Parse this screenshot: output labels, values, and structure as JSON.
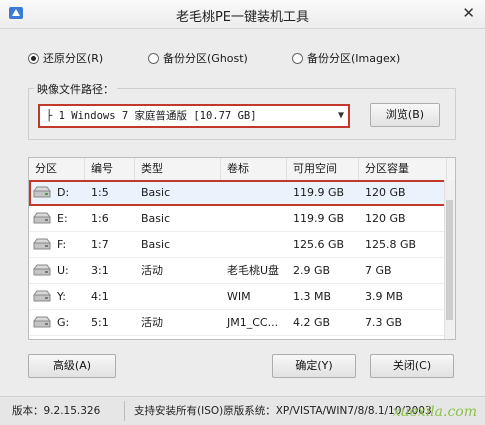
{
  "window": {
    "title": "老毛桃PE一键装机工具",
    "close_glyph": "✕"
  },
  "modes": [
    {
      "label": "还原分区(R)",
      "selected": true
    },
    {
      "label": "备份分区(Ghost)",
      "selected": false
    },
    {
      "label": "备份分区(Imagex)",
      "selected": false
    }
  ],
  "image_path": {
    "label": "映像文件路径：",
    "value": "├ 1 Windows 7 家庭普通版 [10.77 GB]",
    "browse_label": "浏览(B)"
  },
  "table": {
    "headers": [
      "分区",
      "编号",
      "类型",
      "卷标",
      "可用空间",
      "分区容量"
    ],
    "rows": [
      {
        "drive": "D:",
        "number": "1:5",
        "type": "Basic",
        "label": "",
        "free": "119.9 GB",
        "size": "120 GB"
      },
      {
        "drive": "E:",
        "number": "1:6",
        "type": "Basic",
        "label": "",
        "free": "119.9 GB",
        "size": "120 GB"
      },
      {
        "drive": "F:",
        "number": "1:7",
        "type": "Basic",
        "label": "",
        "free": "125.6 GB",
        "size": "125.8 GB"
      },
      {
        "drive": "U:",
        "number": "3:1",
        "type": "活动",
        "label": "老毛桃U盘",
        "free": "2.9 GB",
        "size": "7 GB"
      },
      {
        "drive": "Y:",
        "number": "4:1",
        "type": "",
        "label": "WIM",
        "free": "1.3 MB",
        "size": "3.9 MB"
      },
      {
        "drive": "G:",
        "number": "5:1",
        "type": "活动",
        "label": "JM1_CC...",
        "free": "4.2 GB",
        "size": "7.3 GB"
      }
    ],
    "selected_row": 0
  },
  "buttons": {
    "advanced": "高级(A)",
    "confirm": "确定(Y)",
    "close": "关闭(C)"
  },
  "status": {
    "version": "版本：9.2.15.326",
    "support": "支持安装所有(ISO)原版系统：XP/VISTA/WIN7/8/8.1/10/2003"
  },
  "watermark": "xuexila.com",
  "colors": {
    "highlight": "#c0392b",
    "watermark": "#8bc34a"
  }
}
